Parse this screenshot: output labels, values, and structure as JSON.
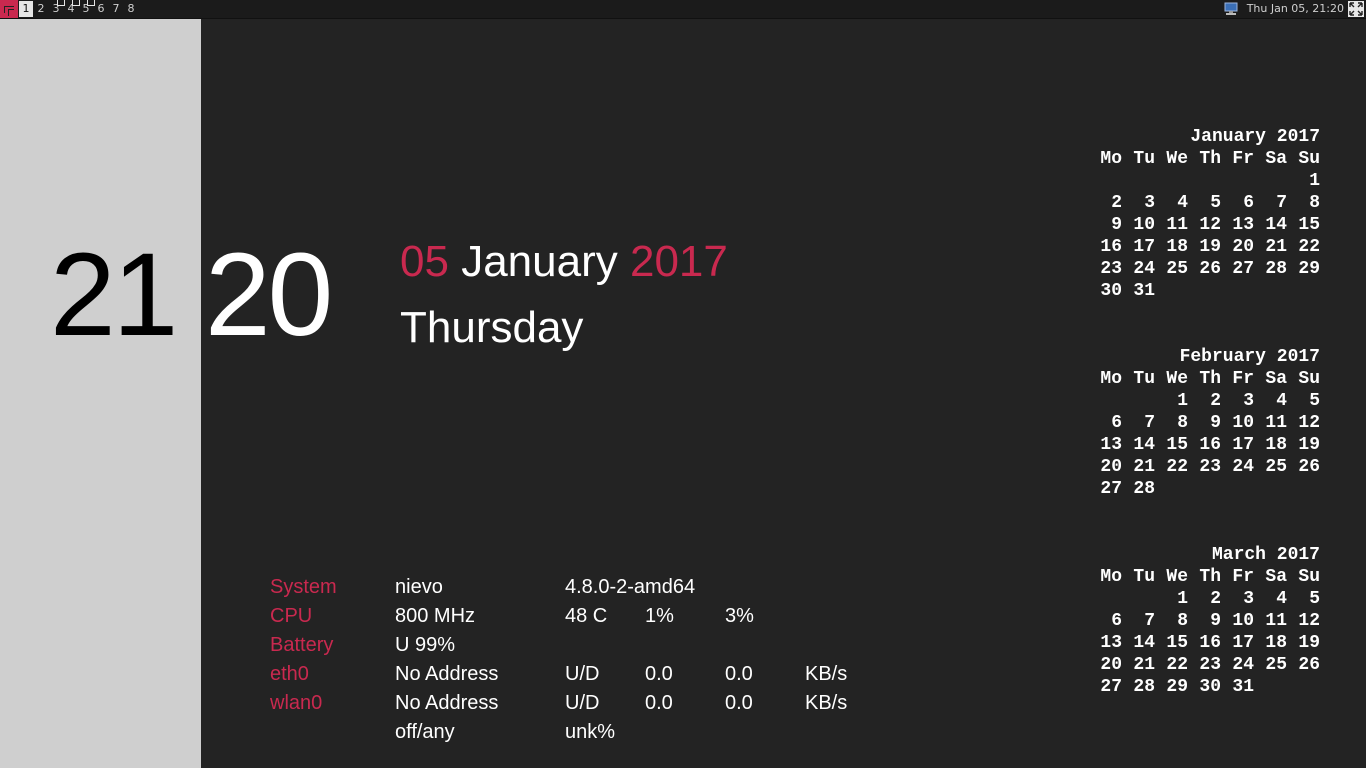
{
  "topbar": {
    "tags": [
      "1",
      "2",
      "3",
      "4",
      "5",
      "6",
      "7",
      "8"
    ],
    "active_tag": "1",
    "datetime": "Thu Jan 05, 21:20"
  },
  "icons": {
    "layout": "tile-layout-icon",
    "network": "network-monitor-icon",
    "fullscreen": "fullscreen-icon"
  },
  "colors": {
    "accent": "#c9294f"
  },
  "clock": {
    "hour": "21",
    "minute": "20"
  },
  "date": {
    "day": "05",
    "month": "January",
    "year": "2017",
    "weekday": "Thursday"
  },
  "sysinfo": {
    "rows": [
      [
        "System",
        "nievo",
        "4.8.0-2-amd64",
        "",
        "",
        ""
      ],
      [
        "CPU",
        "800 MHz",
        "48 C",
        "1%",
        "3%",
        ""
      ],
      [
        "Battery",
        "U 99%",
        "",
        "",
        "",
        ""
      ],
      [
        "eth0",
        "No Address",
        "U/D",
        "0.0",
        "0.0",
        "KB/s"
      ],
      [
        "wlan0",
        "No Address",
        "U/D",
        "0.0",
        "0.0",
        "KB/s"
      ],
      [
        "",
        "off/any",
        "unk%",
        "",
        "",
        ""
      ]
    ]
  },
  "calendars": [
    {
      "title": "January 2017",
      "header": [
        "Mo",
        "Tu",
        "We",
        "Th",
        "Fr",
        "Sa",
        "Su"
      ],
      "cells": [
        "",
        "",
        "",
        "",
        "",
        "",
        "1",
        "2",
        "3",
        "4",
        "5",
        "6",
        "7",
        "8",
        "9",
        "10",
        "11",
        "12",
        "13",
        "14",
        "15",
        "16",
        "17",
        "18",
        "19",
        "20",
        "21",
        "22",
        "23",
        "24",
        "25",
        "26",
        "27",
        "28",
        "29",
        "30",
        "31"
      ]
    },
    {
      "title": "February 2017",
      "header": [
        "Mo",
        "Tu",
        "We",
        "Th",
        "Fr",
        "Sa",
        "Su"
      ],
      "cells": [
        "",
        "",
        "1",
        "2",
        "3",
        "4",
        "5",
        "6",
        "7",
        "8",
        "9",
        "10",
        "11",
        "12",
        "13",
        "14",
        "15",
        "16",
        "17",
        "18",
        "19",
        "20",
        "21",
        "22",
        "23",
        "24",
        "25",
        "26",
        "27",
        "28"
      ]
    },
    {
      "title": "March 2017",
      "header": [
        "Mo",
        "Tu",
        "We",
        "Th",
        "Fr",
        "Sa",
        "Su"
      ],
      "cells": [
        "",
        "",
        "1",
        "2",
        "3",
        "4",
        "5",
        "6",
        "7",
        "8",
        "9",
        "10",
        "11",
        "12",
        "13",
        "14",
        "15",
        "16",
        "17",
        "18",
        "19",
        "20",
        "21",
        "22",
        "23",
        "24",
        "25",
        "26",
        "27",
        "28",
        "29",
        "30",
        "31"
      ]
    }
  ]
}
